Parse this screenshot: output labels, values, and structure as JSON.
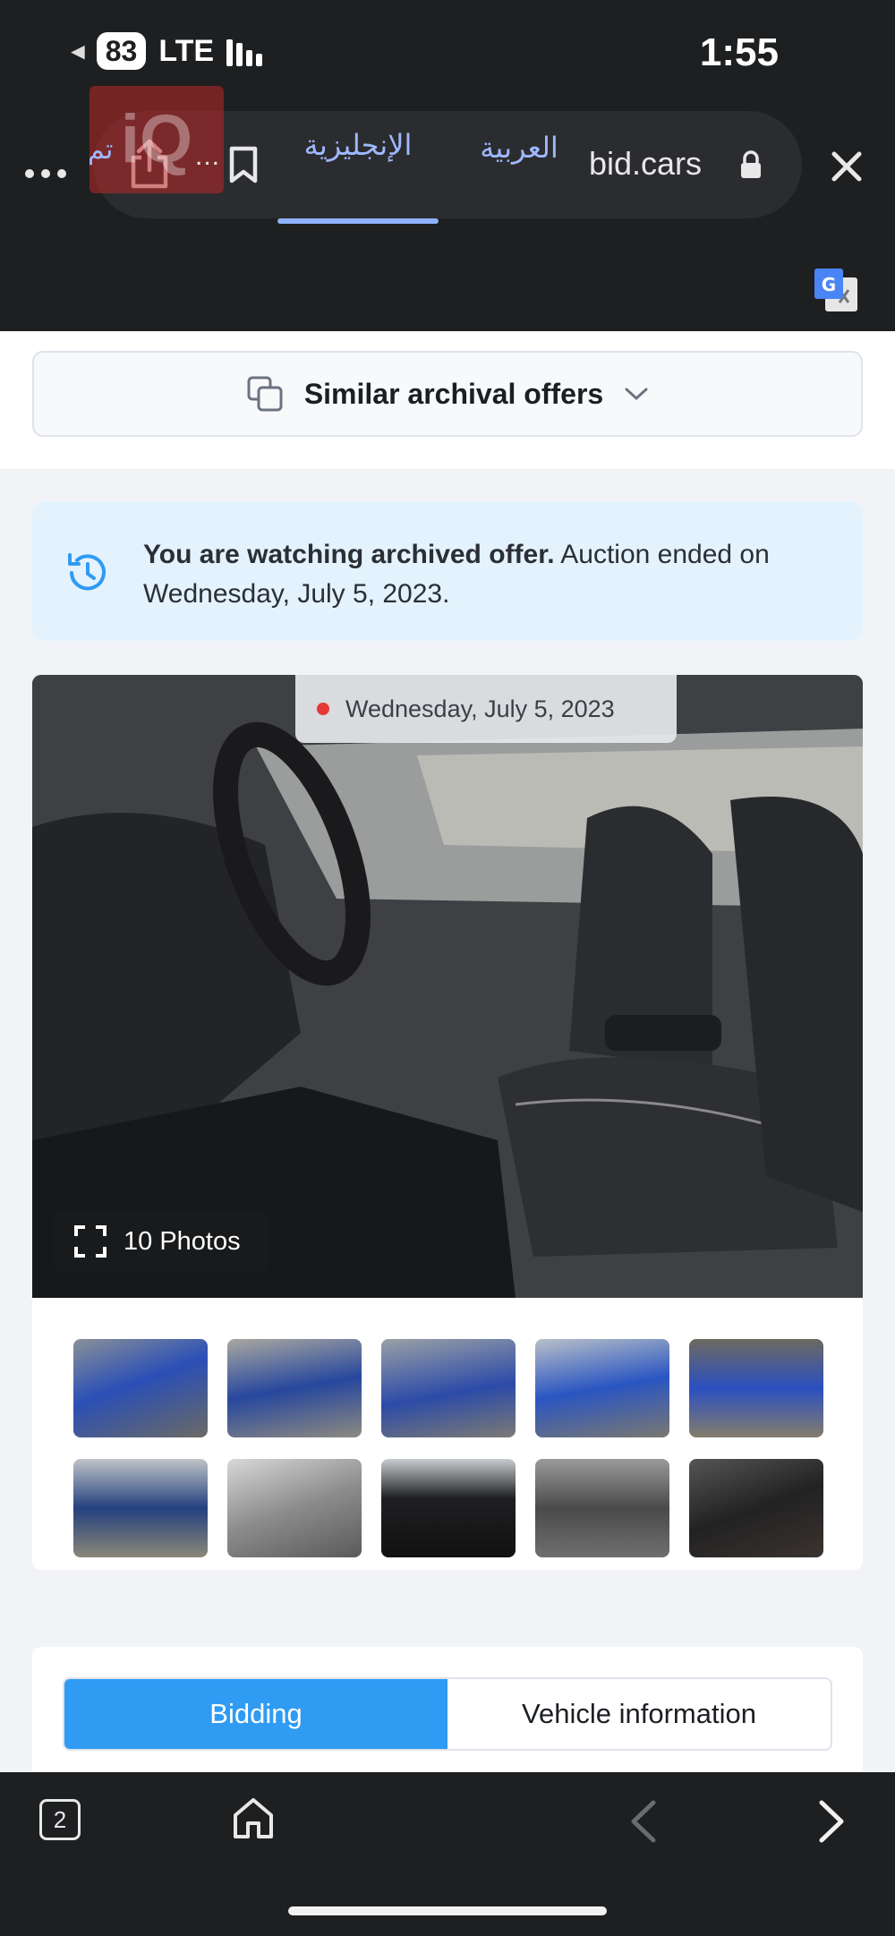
{
  "status_bar": {
    "battery": "83",
    "network": "LTE",
    "time": "1:55"
  },
  "browser": {
    "url": "bid.cars",
    "translate": {
      "done_label": "تم",
      "more_label": "...",
      "tab_english": "الإنجليزية",
      "tab_arabic": "العربية"
    }
  },
  "page": {
    "similar_offers_label": "Similar archival offers",
    "notice": {
      "bold": "You are watching archived offer.",
      "rest": " Auction ended on Wednesday, July 5, 2023."
    },
    "gallery": {
      "date": "Wednesday, July 5, 2023",
      "photos_label": "10 Photos"
    },
    "tabs": {
      "bidding": "Bidding",
      "vehicle_info": "Vehicle information"
    }
  },
  "bottom_bar": {
    "tab_count": "2"
  },
  "colors": {
    "accent": "#2f9bf3",
    "notice_bg": "#e4f2fd",
    "toolbar_bg": "#1e1f21",
    "translate_link": "#9fb8ff",
    "status_dot": "#e53935"
  }
}
